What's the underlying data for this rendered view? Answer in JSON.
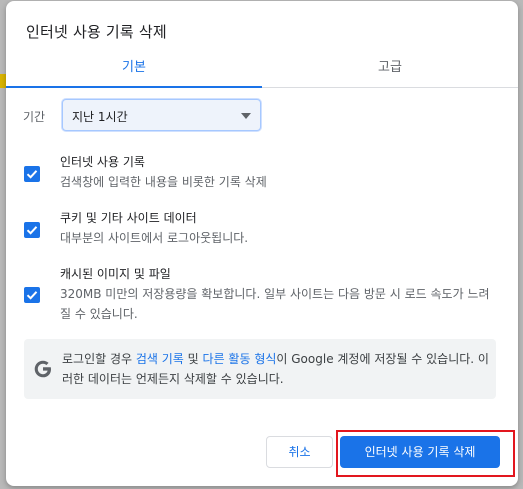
{
  "dialog": {
    "title": "인터넷 사용 기록 삭제"
  },
  "tabs": [
    {
      "label": "기본",
      "selected": true
    },
    {
      "label": "고급",
      "selected": false
    }
  ],
  "time_range": {
    "label": "기간",
    "selected_value": "지난 1시간"
  },
  "options": [
    {
      "title": "인터넷 사용 기록",
      "description": "검색창에 입력한 내용을 비롯한 기록 삭제",
      "checked": true
    },
    {
      "title": "쿠키 및 기타 사이트 데이터",
      "description": "대부분의 사이트에서 로그아웃됩니다.",
      "checked": true
    },
    {
      "title": "캐시된 이미지 및 파일",
      "description": "320MB 미만의 저장용량을 확보합니다. 일부 사이트는 다음 방문 시 로드 속도가 느려질 수 있습니다.",
      "checked": true
    }
  ],
  "info": {
    "icon": "google-g-icon",
    "prefix": "로그인할 경우 ",
    "link1": "검색 기록",
    "mid1": " 및 ",
    "link2": "다른 활동 형식",
    "suffix": "이 Google 계정에 저장될 수 있습니다. 이러한 데이터는 언제든지 삭제할 수 있습니다."
  },
  "buttons": {
    "cancel": "취소",
    "confirm": "인터넷 사용 기록 삭제"
  },
  "colors": {
    "accent": "#1a73e8",
    "highlight_outline": "#e2161e",
    "info_background": "#f1f3f4"
  }
}
